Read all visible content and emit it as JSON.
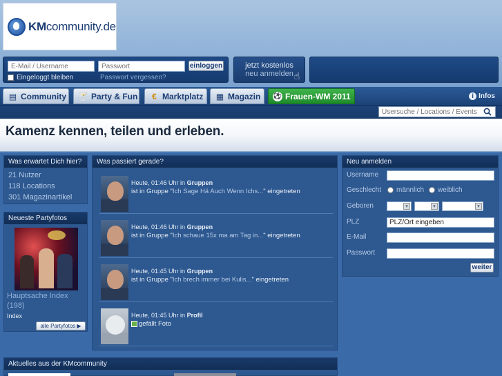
{
  "logo": {
    "brand": "KM",
    "suffix": "community.de"
  },
  "login": {
    "email_placeholder": "E-Mail / Username",
    "password_placeholder": "Passwort",
    "login_button": "einloggen",
    "remember_label": "Eingeloggt bleiben",
    "forgot_link": "Passwort vergessen?"
  },
  "register_cta": {
    "line1": "jetzt kostenlos",
    "line2": "neu anmelden"
  },
  "nav": {
    "tabs": [
      {
        "label": "Community",
        "icon": "community-icon"
      },
      {
        "label": "Party & Fun",
        "icon": "cocktail-icon"
      },
      {
        "label": "Marktplatz",
        "icon": "euro-icon"
      },
      {
        "label": "Magazin",
        "icon": "magazine-icon"
      },
      {
        "label": "Frauen-WM 2011",
        "icon": "soccer-ball-icon"
      }
    ],
    "infos": "Infos"
  },
  "search": {
    "placeholder": "Usersuche / Locations / Events"
  },
  "hero": {
    "title": "Kamenz kennen, teilen und erleben."
  },
  "expect": {
    "header": "Was erwartet Dich hier?",
    "stats": [
      "21 Nutzer",
      "118 Locations",
      "301 Magazinartikel"
    ]
  },
  "partyfotos": {
    "header": "Neueste Partyfotos",
    "title": "Hauptsache Index",
    "count": "(198)",
    "subtitle": "Index",
    "all_button": "alle Partyfotos"
  },
  "news": {
    "header": "Was passiert gerade?",
    "items": [
      {
        "time": "Heute, 01:46 Uhr in ",
        "section": "Gruppen",
        "pre": "ist in Gruppe \"",
        "quote": "Ich Sage Hä Auch Wenn Ichs...",
        "post": "\" eingetreten"
      },
      {
        "time": "Heute, 01:46 Uhr in ",
        "section": "Gruppen",
        "pre": "ist in Gruppe \"",
        "quote": "Ich schaue 15x ma am Tag in...",
        "post": "\" eingetreten"
      },
      {
        "time": "Heute, 01:45 Uhr in ",
        "section": "Gruppen",
        "pre": "ist in Gruppe \"",
        "quote": "Ich brech immer bei Kulis...",
        "post": "\" eingetreten"
      },
      {
        "time": "Heute, 01:45 Uhr in ",
        "section": "Profil",
        "pre": "gefällt Foto",
        "quote": "",
        "post": ""
      }
    ]
  },
  "register": {
    "header": "Neu anmelden",
    "username_label": "Username",
    "gender_label": "Geschlecht",
    "male": "männlich",
    "female": "weiblich",
    "born_label": "Geboren",
    "zip_label": "PLZ",
    "zip_value": "PLZ/Ort eingeben",
    "email_label": "E-Mail",
    "password_label": "Passwort",
    "submit": "weiter"
  },
  "current": {
    "header": "Aktuelles aus der KMcommunity"
  }
}
